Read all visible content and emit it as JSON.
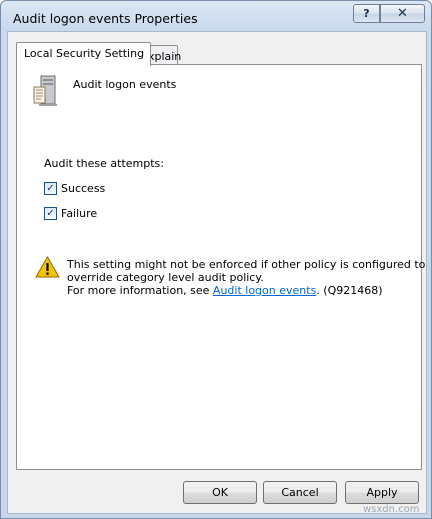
{
  "window": {
    "title": "Audit logon events Properties",
    "help_glyph": "?",
    "close_glyph": "✕"
  },
  "tabs": [
    {
      "label": "Local Security Setting",
      "active": true
    },
    {
      "label": "Explain",
      "active": false
    }
  ],
  "policy": {
    "icon": "policy-computer-icon",
    "name": "Audit logon events"
  },
  "audit": {
    "label": "Audit these attempts:",
    "options": [
      {
        "label": "Success",
        "checked": true
      },
      {
        "label": "Failure",
        "checked": true
      }
    ]
  },
  "warning": {
    "icon": "warning-icon",
    "line1": "This setting might not be enforced if other policy is configured to",
    "line2": "override category level audit policy.",
    "line3_prefix": "For more information, see",
    "link_text": "Audit logon events",
    "line3_suffix": ". (Q921468)"
  },
  "buttons": {
    "ok": "OK",
    "cancel": "Cancel",
    "apply": "Apply"
  },
  "watermark": "wsxdn.com",
  "colors": {
    "link": "#0066cc",
    "frame": "#c9d9ee",
    "dialog_bg": "#f0f0f0"
  }
}
